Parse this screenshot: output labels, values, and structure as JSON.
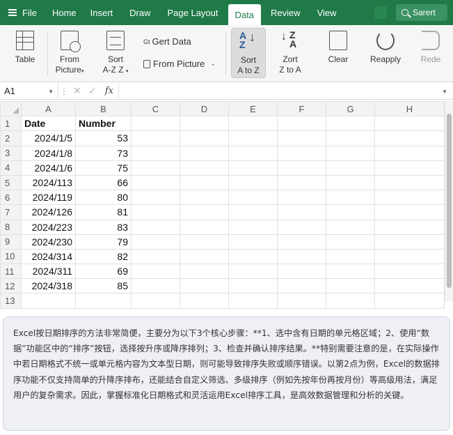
{
  "menu": {
    "file": "File",
    "tabs": [
      "Home",
      "Insert",
      "Draw",
      "Page Layout",
      "Data",
      "Review",
      "View"
    ],
    "active_tab": "Data",
    "search_label": "Sarert"
  },
  "ribbon": {
    "table": "Table",
    "from_picture_1a": "From",
    "from_picture_1b": "Picture",
    "sort_a": "Sort",
    "sort_b": "A-Z Z",
    "get_data_sup": "Gt",
    "get_data": "Gert Data",
    "from_picture_2": "From Picture",
    "sort_az_a": "Sort",
    "sort_az_b": "A to Z",
    "sort_za_a": "Zort",
    "sort_za_b": "Z to A",
    "clear": "Clear",
    "reapply": "Reapply",
    "redo": "Rede"
  },
  "formula_bar": {
    "name_box": "A1",
    "fx": "fx",
    "content": ""
  },
  "sheet": {
    "columns": [
      "A",
      "B",
      "C",
      "D",
      "E",
      "F",
      "G",
      "H"
    ],
    "header_row": {
      "row": "1",
      "a": "Date",
      "b": "Number"
    },
    "rows": [
      {
        "row": "2",
        "date": "2024/1/5",
        "number": "53"
      },
      {
        "row": "3",
        "date": "2024/1/8",
        "number": "73"
      },
      {
        "row": "4",
        "date": "2024/1/6",
        "number": "75"
      },
      {
        "row": "5",
        "date": "2024/113",
        "number": "66"
      },
      {
        "row": "6",
        "date": "2024/119",
        "number": "80"
      },
      {
        "row": "7",
        "date": "2024/126",
        "number": "81"
      },
      {
        "row": "8",
        "date": "2024/223",
        "number": "83"
      },
      {
        "row": "9",
        "date": "2024/230",
        "number": "79"
      },
      {
        "row": "10",
        "date": "2024/314",
        "number": "82"
      },
      {
        "row": "11",
        "date": "2024/311",
        "number": "69"
      },
      {
        "row": "12",
        "date": "2024/318",
        "number": "85"
      },
      {
        "row": "13",
        "date": "",
        "number": ""
      }
    ]
  },
  "explanation": "Excel按日期排序的方法非常简便，主要分为以下3个核心步骤：**1、选中含有日期的单元格区域；2、使用“数据”功能区中的“排序”按钮，选择按升序或降序排列；3、检查并确认排序结果。**特别需要注意的是，在实际操作中若日期格式不统一或单元格内容为文本型日期，则可能导致排序失败或顺序错误。以第2点为例，Excel的数据排序功能不仅支持简单的升降序排布，还能结合自定义筛选、多级排序（例如先按年份再按月份）等高级用法，满足用户的复杂需求。因此，掌握标准化日期格式和灵活运用Excel排序工具，是高效数据管理和分析的关键。"
}
